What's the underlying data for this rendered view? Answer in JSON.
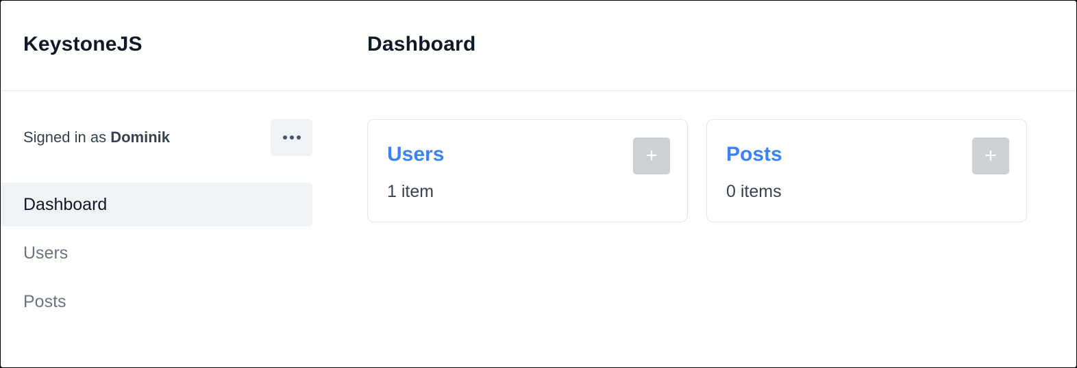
{
  "app": {
    "brand": "KeystoneJS",
    "page_title": "Dashboard"
  },
  "session": {
    "prefix": "Signed in as",
    "user": "Dominik",
    "more_icon": "ellipsis-icon"
  },
  "nav": {
    "items": [
      {
        "label": "Dashboard",
        "active": true
      },
      {
        "label": "Users",
        "active": false
      },
      {
        "label": "Posts",
        "active": false
      }
    ]
  },
  "cards": [
    {
      "title": "Users",
      "count": "1 item",
      "add_icon": "plus-icon"
    },
    {
      "title": "Posts",
      "count": "0 items",
      "add_icon": "plus-icon"
    }
  ],
  "colors": {
    "accent": "#3b82f6",
    "active_bg": "#eff3f6",
    "add_button_bg": "#cdd1d5"
  }
}
